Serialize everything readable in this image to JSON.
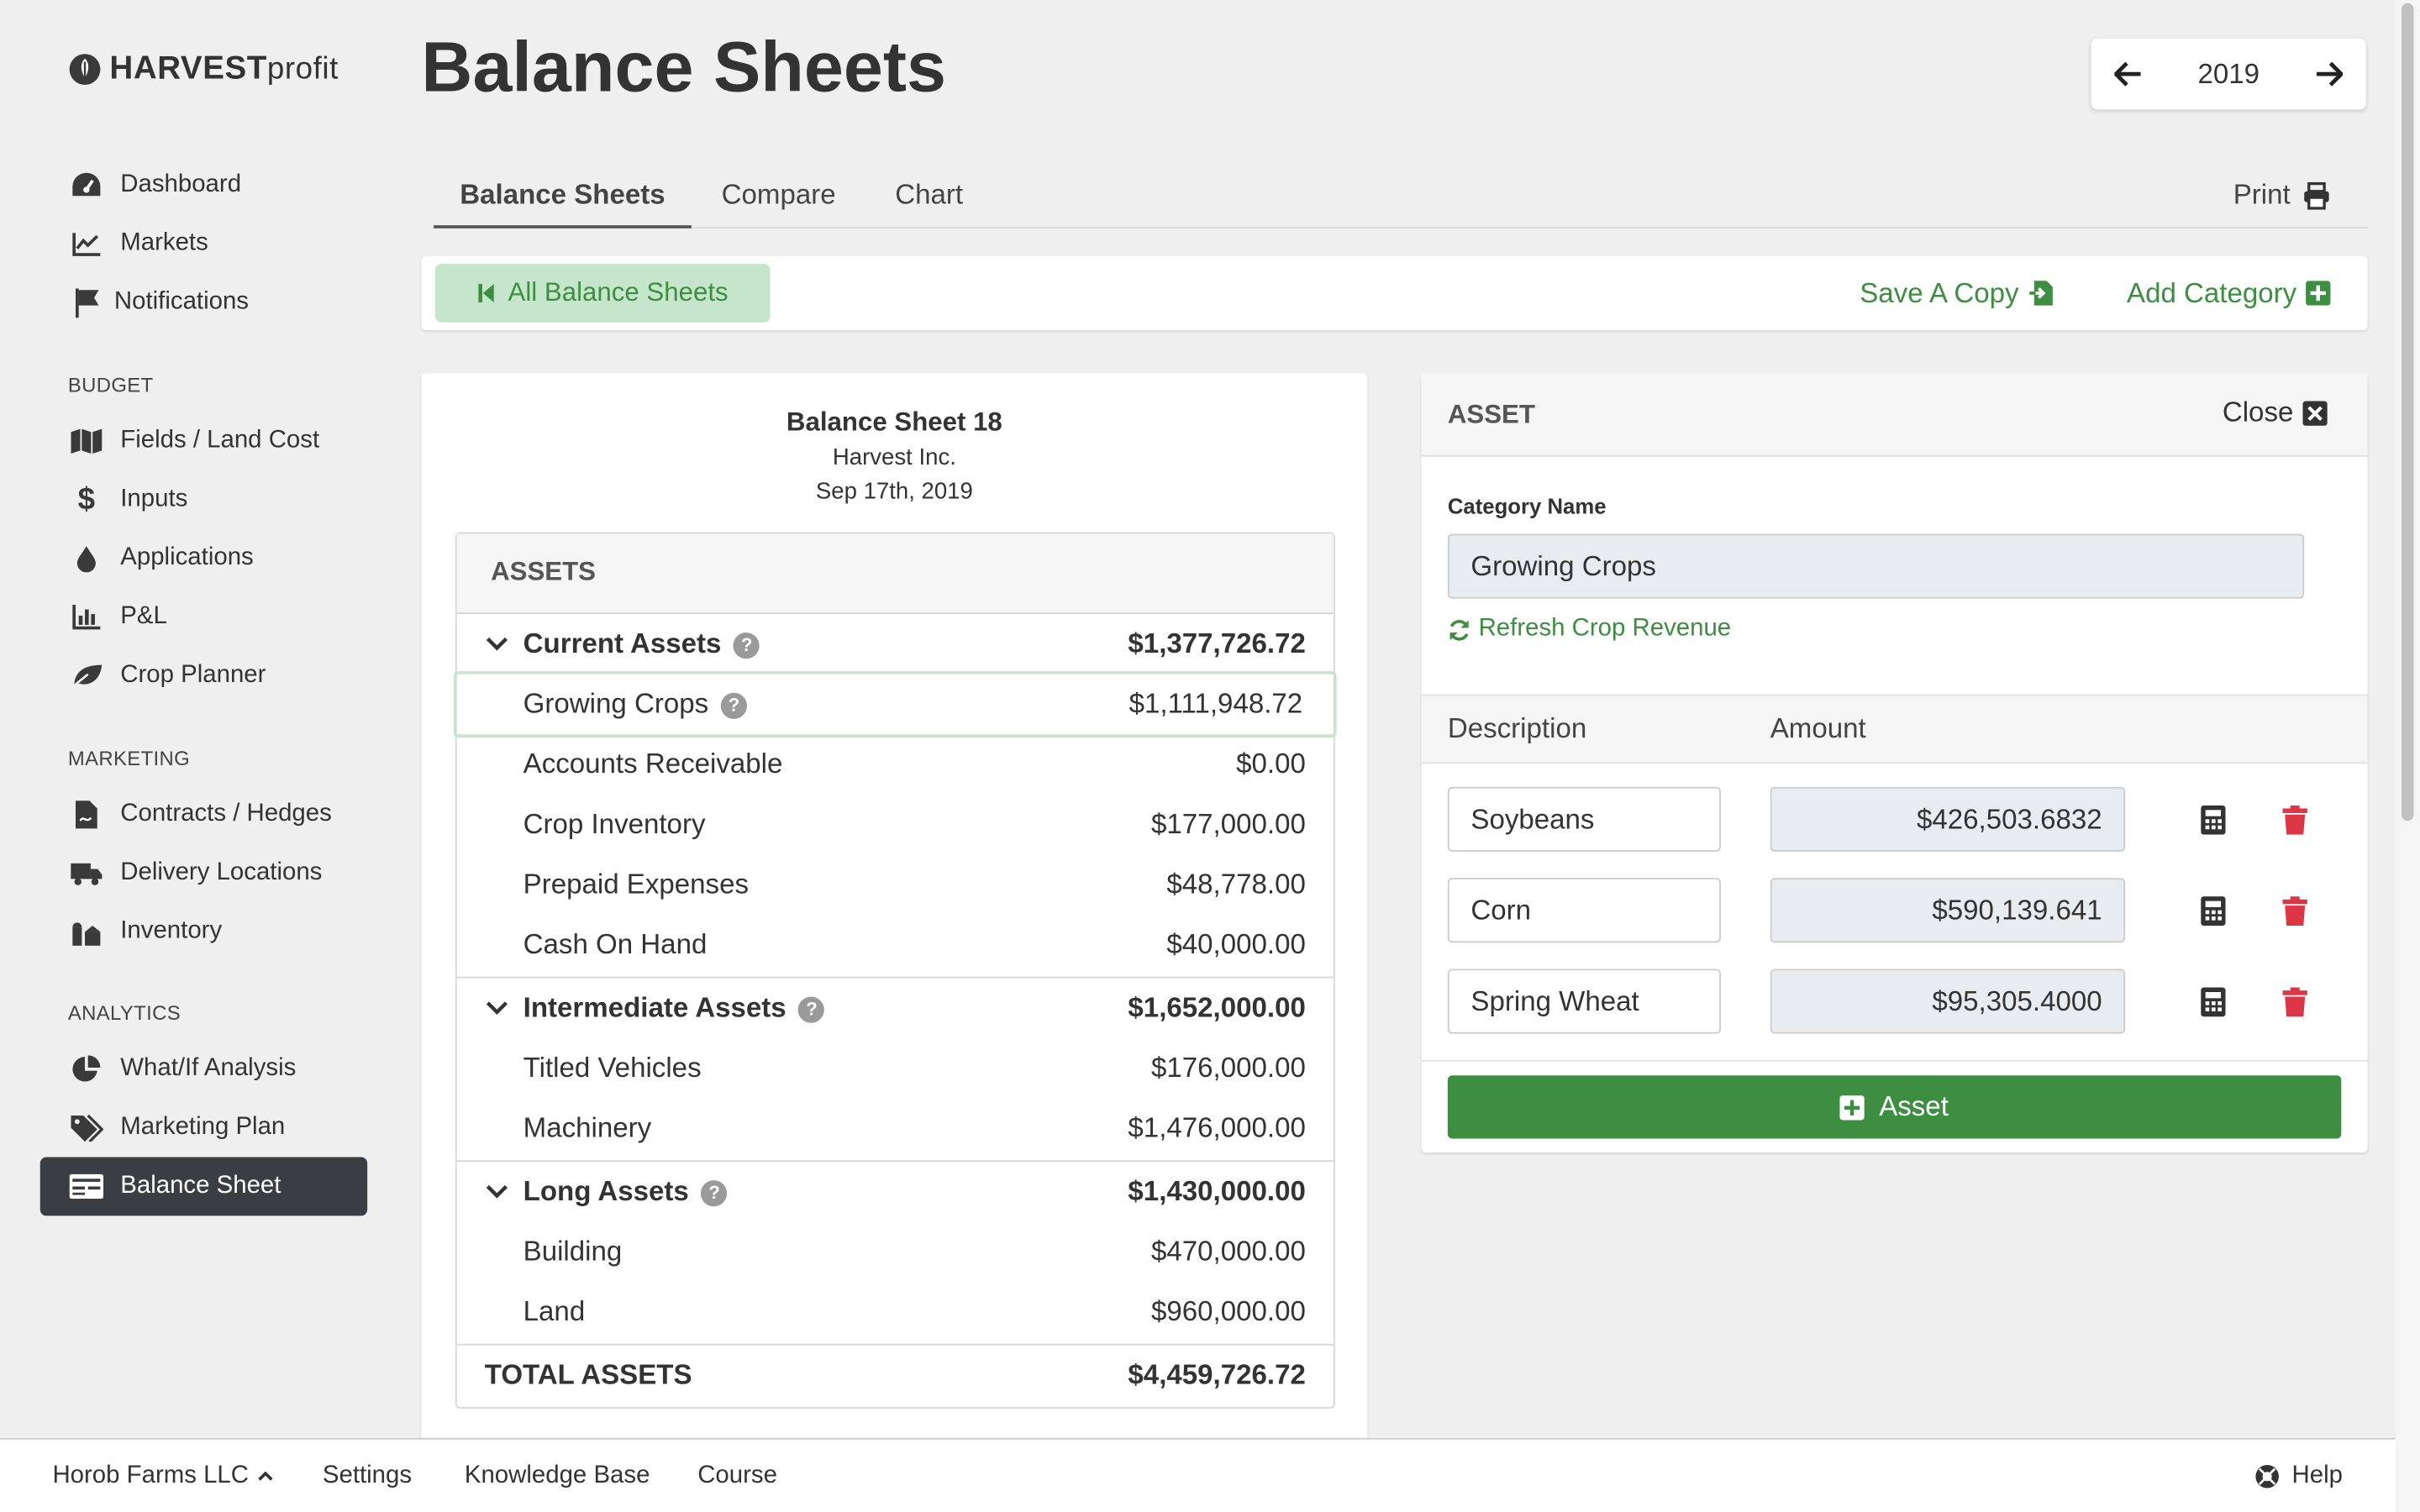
{
  "brand": {
    "name_bold": "HARVEST",
    "name_light": "profit"
  },
  "sidebar": {
    "main_items": [
      {
        "label": "Dashboard",
        "icon": "dashboard-gauge-icon"
      },
      {
        "label": "Markets",
        "icon": "line-chart-icon"
      },
      {
        "label": "Notifications",
        "icon": "flag-icon"
      }
    ],
    "budget": {
      "heading": "BUDGET",
      "items": [
        {
          "label": "Fields / Land Cost",
          "icon": "map-icon"
        },
        {
          "label": "Inputs",
          "icon": "dollar-icon"
        },
        {
          "label": "Applications",
          "icon": "droplet-icon"
        },
        {
          "label": "P&L",
          "icon": "bar-chart-icon"
        },
        {
          "label": "Crop Planner",
          "icon": "leaf-icon"
        }
      ]
    },
    "marketing": {
      "heading": "MARKETING",
      "items": [
        {
          "label": "Contracts / Hedges",
          "icon": "contract-file-icon"
        },
        {
          "label": "Delivery Locations",
          "icon": "truck-icon"
        },
        {
          "label": "Inventory",
          "icon": "silo-icon"
        }
      ]
    },
    "analytics": {
      "heading": "ANALYTICS",
      "items": [
        {
          "label": "What/If Analysis",
          "icon": "pie-chart-icon"
        },
        {
          "label": "Marketing Plan",
          "icon": "tags-icon"
        },
        {
          "label": "Balance Sheet",
          "icon": "balance-sheet-icon",
          "active": true
        }
      ]
    }
  },
  "header": {
    "title": "Balance Sheets",
    "year": "2019"
  },
  "tabs": {
    "items": [
      "Balance Sheets",
      "Compare",
      "Chart"
    ],
    "active": "Balance Sheets",
    "print_label": "Print"
  },
  "toolbar": {
    "all_label": "All Balance Sheets",
    "save_copy_label": "Save A Copy",
    "add_category_label": "Add Category"
  },
  "sheet": {
    "title": "Balance Sheet 18",
    "company": "Harvest Inc.",
    "date": "Sep 17th, 2019",
    "section_label": "ASSETS",
    "groups": [
      {
        "name": "Current Assets",
        "total": "$1,377,726.72",
        "items": [
          {
            "name": "Growing Crops",
            "amount": "$1,111,948.72",
            "help": true,
            "selected": true
          },
          {
            "name": "Accounts Receivable",
            "amount": "$0.00"
          },
          {
            "name": "Crop Inventory",
            "amount": "$177,000.00"
          },
          {
            "name": "Prepaid Expenses",
            "amount": "$48,778.00"
          },
          {
            "name": "Cash On Hand",
            "amount": "$40,000.00"
          }
        ]
      },
      {
        "name": "Intermediate Assets",
        "total": "$1,652,000.00",
        "items": [
          {
            "name": "Titled Vehicles",
            "amount": "$176,000.00"
          },
          {
            "name": "Machinery",
            "amount": "$1,476,000.00"
          }
        ]
      },
      {
        "name": "Long Assets",
        "total": "$1,430,000.00",
        "items": [
          {
            "name": "Building",
            "amount": "$470,000.00"
          },
          {
            "name": "Land",
            "amount": "$960,000.00"
          }
        ]
      }
    ],
    "total_label": "TOTAL ASSETS",
    "total_value": "$4,459,726.72"
  },
  "editor": {
    "heading": "ASSET",
    "close_label": "Close",
    "category_label": "Category Name",
    "category_value": "Growing Crops",
    "refresh_label": "Refresh Crop Revenue",
    "col_description": "Description",
    "col_amount": "Amount",
    "rows": [
      {
        "description": "Soybeans",
        "amount": "$426,503.6832"
      },
      {
        "description": "Corn",
        "amount": "$590,139.641"
      },
      {
        "description": "Spring Wheat",
        "amount": "$95,305.4000"
      }
    ],
    "add_label": "Asset"
  },
  "footer": {
    "org": "Horob Farms LLC",
    "links": [
      "Settings",
      "Knowledge Base",
      "Course"
    ],
    "help": "Help"
  },
  "colors": {
    "accent_green": "#3e8e41",
    "danger_red": "#dc3545",
    "sidebar_active": "#3a3e42"
  }
}
